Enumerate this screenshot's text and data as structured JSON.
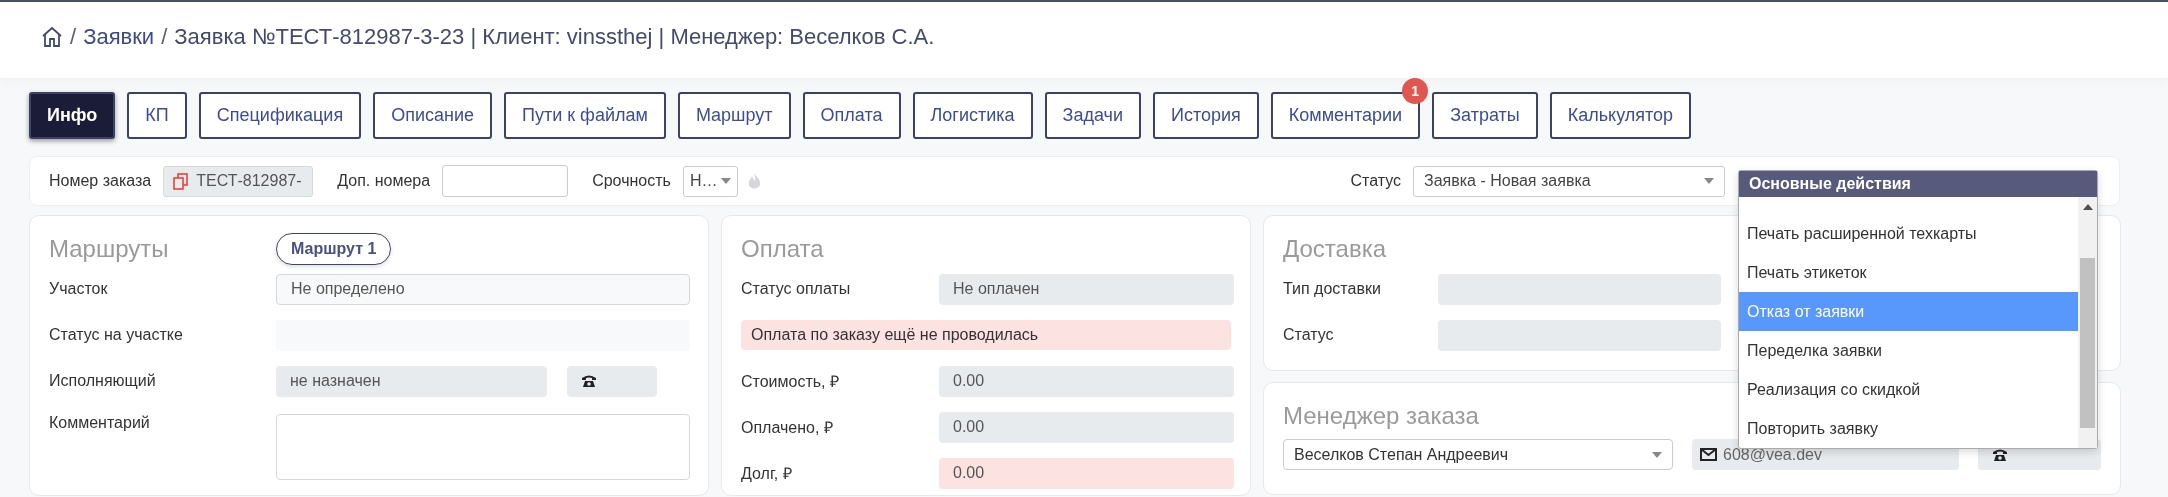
{
  "breadcrumb": [
    {
      "kind": "separator",
      "text": "/"
    },
    {
      "kind": "link",
      "text": "Заявки"
    },
    {
      "kind": "separator",
      "text": "/"
    },
    {
      "kind": "current",
      "text": "Заявка №ТЕСТ-812987-3-23 | Клиент: vinssthej | Менеджер: Веселков С.А."
    }
  ],
  "tabs": [
    {
      "label": "Инфо",
      "selected": true
    },
    {
      "label": "КП",
      "selected": false
    },
    {
      "label": "Спецификация",
      "selected": false
    },
    {
      "label": "Описание",
      "selected": false
    },
    {
      "label": "Пути к файлам",
      "selected": false
    },
    {
      "label": "Маршрут",
      "selected": false
    },
    {
      "label": "Оплата",
      "selected": false
    },
    {
      "label": "Логистика",
      "selected": false
    },
    {
      "label": "Задачи",
      "selected": false
    },
    {
      "label": "История",
      "selected": false
    },
    {
      "label": "Комментарии",
      "selected": false,
      "badge": "1"
    },
    {
      "label": "Затраты",
      "selected": false
    },
    {
      "label": "Калькулятор",
      "selected": false
    }
  ],
  "toolbar": {
    "order_number": {
      "label": "Номер заказа",
      "value": "ТЕСТ-812987-"
    },
    "extra_numbers": {
      "label": "Доп. номера"
    },
    "urgency": {
      "label": "Срочность",
      "value": "Н…"
    },
    "status": {
      "label": "Статус",
      "value": "Заявка - Новая заявка"
    }
  },
  "routes": {
    "title": "Маршруты",
    "route_tabs": [
      {
        "label": "Маршрут 1",
        "selected": true
      }
    ],
    "rows": [
      {
        "kind": "select",
        "label": "Участок",
        "value": "Не определено"
      },
      {
        "kind": "empty",
        "label": "Статус на участке"
      },
      {
        "kind": "assignee",
        "label": "Исполняющий",
        "value": "не назначен"
      },
      {
        "kind": "textarea",
        "label": "Комментарий"
      }
    ]
  },
  "payment": {
    "title": "Оплата",
    "rows": [
      {
        "kind": "field",
        "label": "Статус оплаты",
        "value": "Не оплачен"
      },
      {
        "kind": "alert",
        "text": "Оплата по заказу ещё не проводилась"
      },
      {
        "kind": "field",
        "label": "Стоимость, ₽",
        "value": "0.00"
      },
      {
        "kind": "field",
        "label": "Оплачено, ₽",
        "value": "0.00"
      },
      {
        "kind": "debt",
        "label": "Долг, ₽",
        "value": "0.00"
      }
    ]
  },
  "delivery": {
    "title": "Доставка",
    "rows": [
      {
        "label": "Тип доставки"
      },
      {
        "label": "Статус"
      }
    ]
  },
  "manager": {
    "title": "Менеджер заказа",
    "name": "Веселков Степан Андреевич",
    "email": "608@vea.dev"
  },
  "actions_menu": {
    "title": "Основные действия",
    "items": [
      {
        "label": "Печать расширенной техкарты",
        "selected": false
      },
      {
        "label": "Печать этикеток",
        "selected": false
      },
      {
        "label": "Отказ от заявки",
        "selected": true
      },
      {
        "label": "Переделка заявки",
        "selected": false
      },
      {
        "label": "Реализация со скидкой",
        "selected": false
      },
      {
        "label": "Повторить заявку",
        "selected": false
      }
    ]
  }
}
